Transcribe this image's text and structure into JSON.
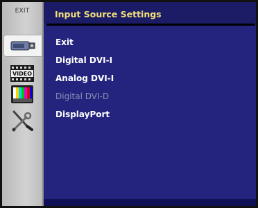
{
  "sidebar": {
    "exit_label": "EXIT",
    "items": [
      {
        "icon": "dvi-connector-icon",
        "active": true
      },
      {
        "icon": "video-film-icon",
        "label": "VIDEO"
      },
      {
        "icon": "color-bars-icon"
      },
      {
        "icon": "tools-icon"
      }
    ]
  },
  "header": {
    "title": "Input Source Settings"
  },
  "menu": {
    "items": [
      {
        "label": "Exit",
        "enabled": true
      },
      {
        "label": "Digital DVI-I",
        "enabled": true
      },
      {
        "label": "Analog DVI-I",
        "enabled": true
      },
      {
        "label": "Digital DVI-D",
        "enabled": false
      },
      {
        "label": "DisplayPort",
        "enabled": true
      }
    ]
  },
  "colors": {
    "background": "#24247f",
    "title_text": "#f3e07a",
    "disabled_text": "#8e8eb4",
    "sidebar": "#c8c8c8"
  }
}
